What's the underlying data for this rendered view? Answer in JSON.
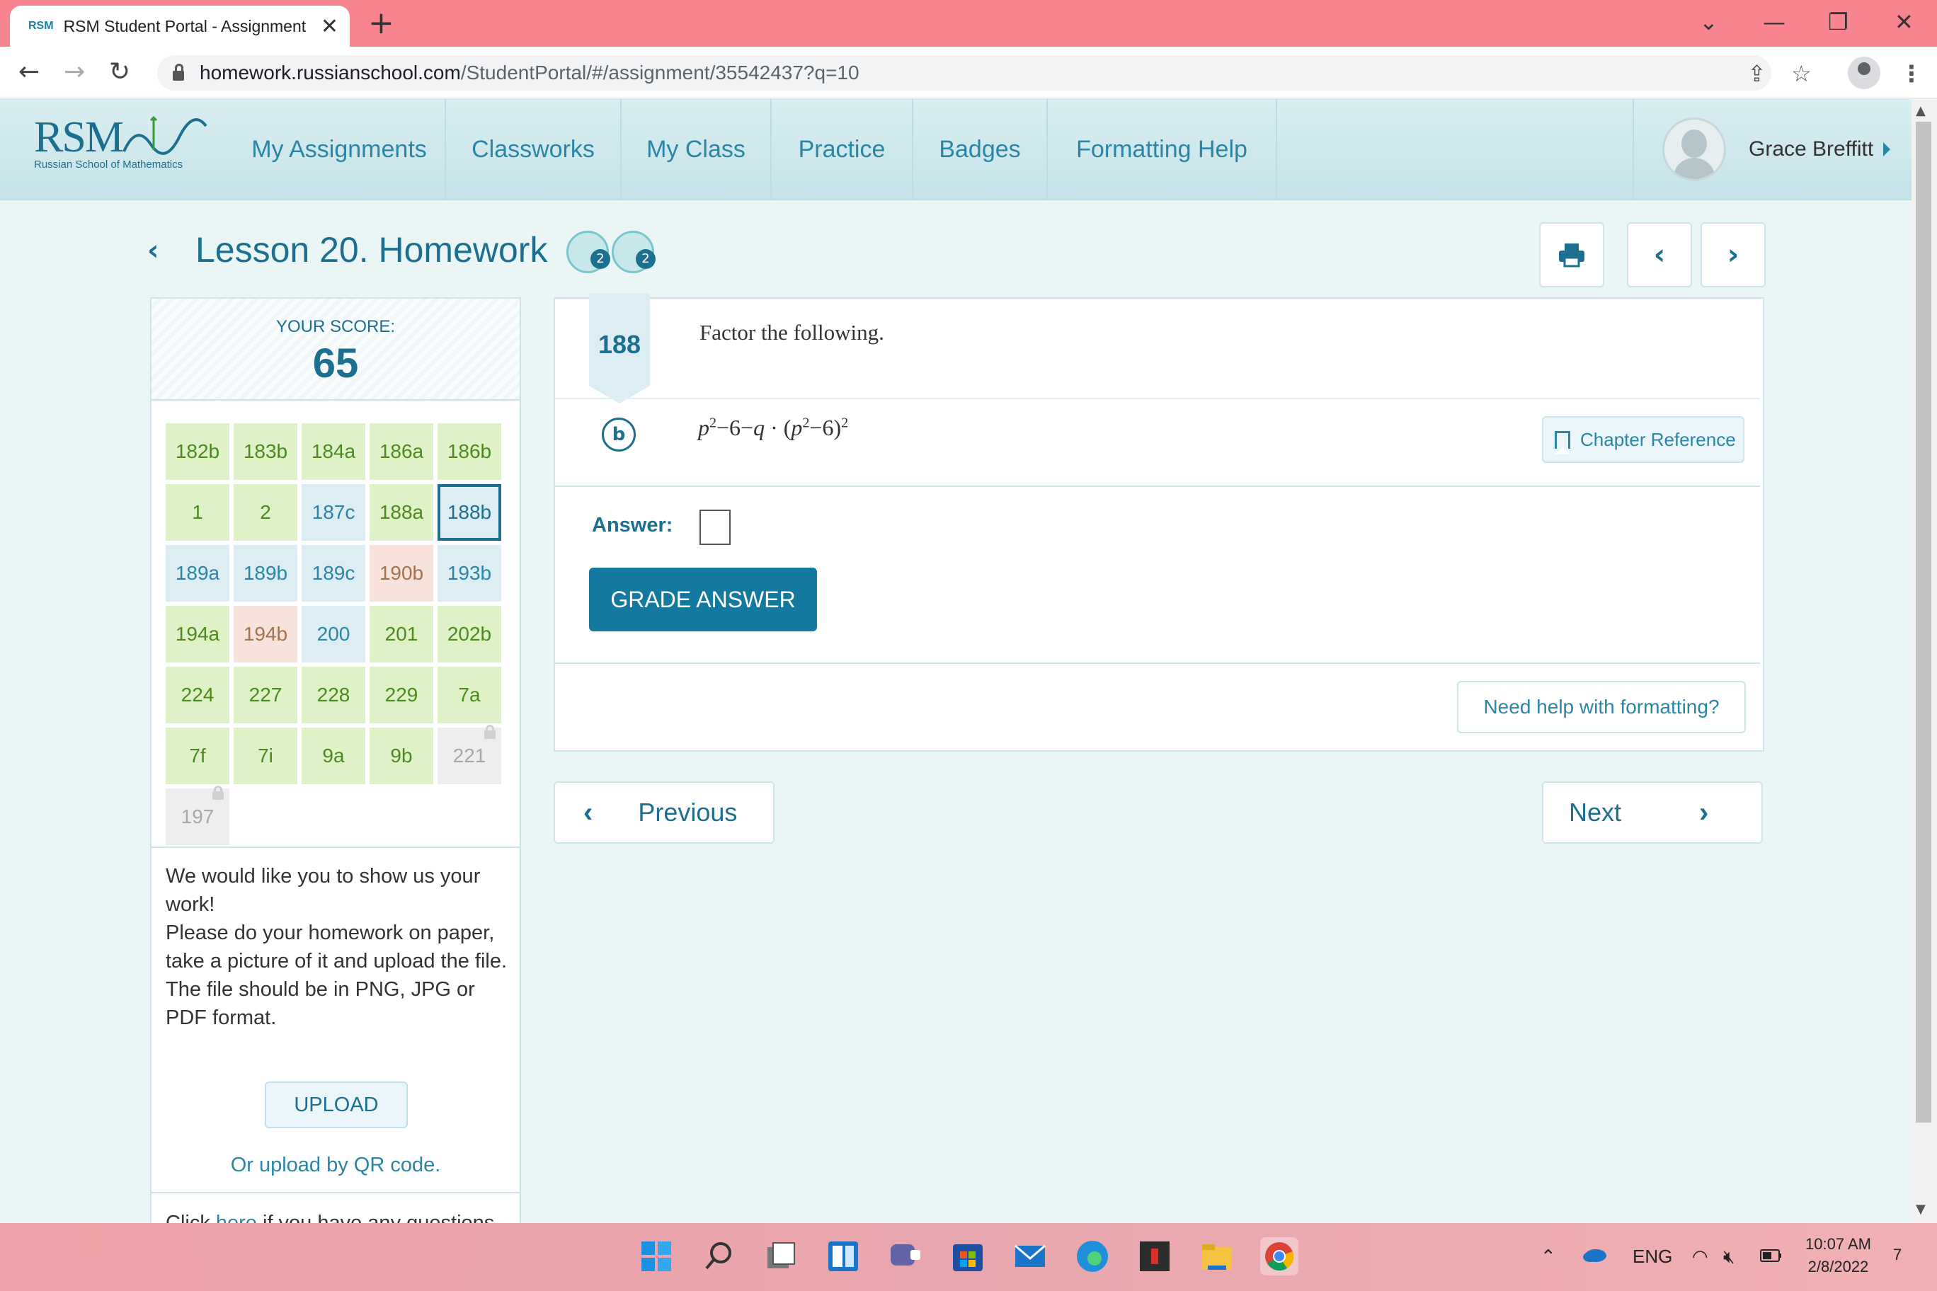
{
  "browser": {
    "tab_favicon": "RSM",
    "tab_title": "RSM Student Portal - Assignment",
    "tab_close": "✕",
    "new_tab": "+",
    "url_host": "homework.russianschool.com",
    "url_path": "/StudentPortal/#/assignment/35542437?q=10"
  },
  "header": {
    "logo_text": "RSM",
    "logo_subtitle": "Russian School of Mathematics",
    "nav": [
      "My Assignments",
      "Classworks",
      "My Class",
      "Practice",
      "Badges",
      "Formatting Help"
    ],
    "user_name": "Grace Breffitt"
  },
  "lesson": {
    "title": "Lesson 20. Homework",
    "badge1_count": "2",
    "badge2_count": "2"
  },
  "score": {
    "label": "YOUR SCORE:",
    "value": "65"
  },
  "problems": [
    {
      "label": "182b",
      "status": "green"
    },
    {
      "label": "183b",
      "status": "green"
    },
    {
      "label": "184a",
      "status": "green"
    },
    {
      "label": "186a",
      "status": "green"
    },
    {
      "label": "186b",
      "status": "green"
    },
    {
      "label": "1",
      "status": "green"
    },
    {
      "label": "2",
      "status": "green"
    },
    {
      "label": "187c",
      "status": "blue"
    },
    {
      "label": "188a",
      "status": "green"
    },
    {
      "label": "188b",
      "status": "selected"
    },
    {
      "label": "189a",
      "status": "blue"
    },
    {
      "label": "189b",
      "status": "blue"
    },
    {
      "label": "189c",
      "status": "blue"
    },
    {
      "label": "190b",
      "status": "pink"
    },
    {
      "label": "193b",
      "status": "blue"
    },
    {
      "label": "194a",
      "status": "green"
    },
    {
      "label": "194b",
      "status": "pink"
    },
    {
      "label": "200",
      "status": "blue"
    },
    {
      "label": "201",
      "status": "green"
    },
    {
      "label": "202b",
      "status": "green"
    },
    {
      "label": "224",
      "status": "green"
    },
    {
      "label": "227",
      "status": "green"
    },
    {
      "label": "228",
      "status": "green"
    },
    {
      "label": "229",
      "status": "green"
    },
    {
      "label": "7a",
      "status": "green"
    },
    {
      "label": "7f",
      "status": "green"
    },
    {
      "label": "7i",
      "status": "green"
    },
    {
      "label": "9a",
      "status": "green"
    },
    {
      "label": "9b",
      "status": "green"
    },
    {
      "label": "221",
      "status": "locked"
    },
    {
      "label": "197",
      "status": "locked"
    }
  ],
  "upload": {
    "line1": "We would like you to show us your work!",
    "line2": "Please do your homework on paper, take a picture of it and upload the file.",
    "line3": "The file should be in PNG, JPG or PDF format.",
    "button": "UPLOAD",
    "qr_link": "Or upload by QR code."
  },
  "help": {
    "prefix": "Click ",
    "link": "here",
    "suffix": " if you have any questions."
  },
  "question": {
    "number": "188",
    "prompt": "Factor the following.",
    "part": "b",
    "chapter_reference": "Chapter Reference",
    "answer_label": "Answer:",
    "grade_button": "GRADE ANSWER",
    "formatting_help": "Need help with formatting?"
  },
  "pager": {
    "previous": "Previous",
    "next": "Next"
  },
  "taskbar": {
    "language": "ENG",
    "time": "10:07 AM",
    "date": "2/8/2022",
    "notifications": "7"
  },
  "colors": {
    "accent": "#1c6f8f",
    "grade_button": "#14799e",
    "titlebar": "#f8848f",
    "cell_green": "#dff2c7",
    "cell_blue": "#dcedf3",
    "cell_pink": "#f7e3dc",
    "cell_locked": "#eeeeee"
  }
}
